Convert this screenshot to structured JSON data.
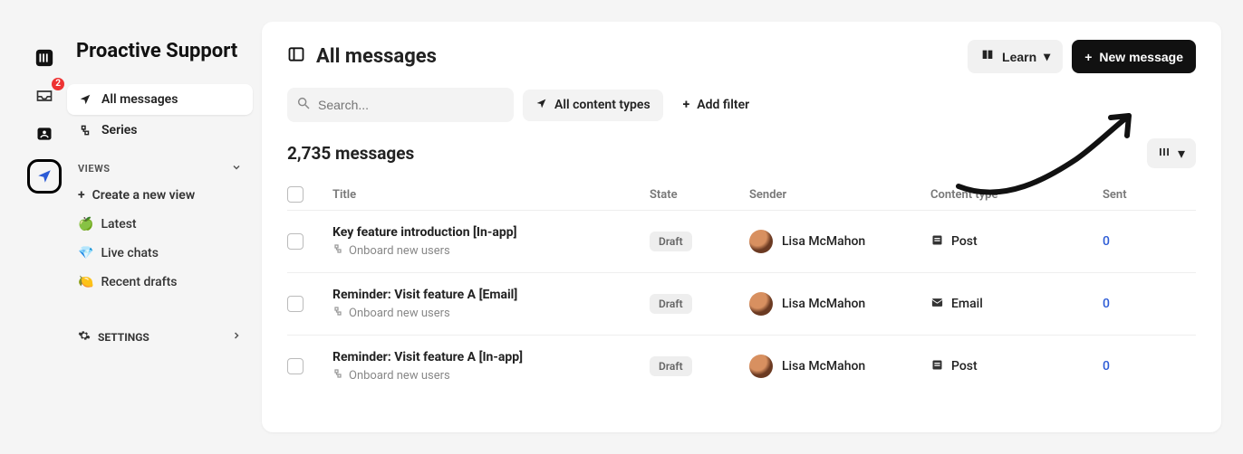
{
  "rail": {
    "inbox_badge": "2"
  },
  "sidebar": {
    "title": "Proactive Support",
    "items": {
      "all_messages": "All messages",
      "series": "Series"
    },
    "views_heading": "VIEWS",
    "create_view": "Create a new view",
    "views": {
      "latest": "Latest",
      "live_chats": "Live chats",
      "recent_drafts": "Recent drafts"
    },
    "views_emoji": {
      "latest": "🍏",
      "live_chats": "💎",
      "recent_drafts": "🍋"
    },
    "settings": "SETTINGS"
  },
  "header": {
    "title": "All messages",
    "learn": "Learn",
    "new_message": "New message"
  },
  "filters": {
    "search_placeholder": "Search...",
    "content_types": "All content types",
    "add_filter": "Add filter"
  },
  "count_label": "2,735 messages",
  "table": {
    "columns": {
      "title": "Title",
      "state": "State",
      "sender": "Sender",
      "content_type": "Content type",
      "sent": "Sent"
    },
    "rows": [
      {
        "title": "Key feature introduction [In-app]",
        "series": "Onboard new users",
        "state": "Draft",
        "sender": "Lisa McMahon",
        "content_type": "Post",
        "sent": "0"
      },
      {
        "title": "Reminder: Visit feature A [Email]",
        "series": "Onboard new users",
        "state": "Draft",
        "sender": "Lisa McMahon",
        "content_type": "Email",
        "sent": "0"
      },
      {
        "title": "Reminder: Visit feature A [In-app]",
        "series": "Onboard new users",
        "state": "Draft",
        "sender": "Lisa McMahon",
        "content_type": "Post",
        "sent": "0"
      }
    ]
  }
}
